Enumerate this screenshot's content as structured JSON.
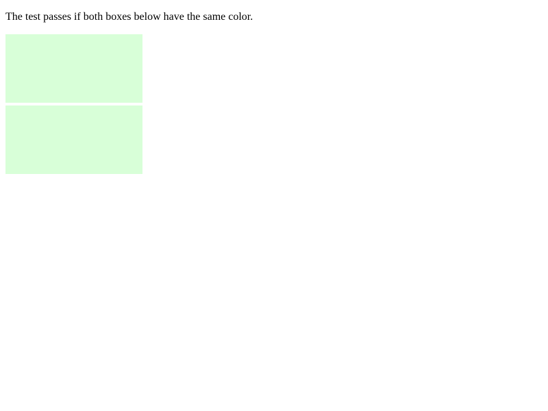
{
  "instruction": {
    "text": "The test passes if both boxes below have the same color."
  },
  "boxes": {
    "items": [
      {
        "color": "#d8ffd8"
      },
      {
        "color": "#d8ffd8"
      }
    ]
  },
  "colors": {
    "background": "#ffffff",
    "text": "#000000"
  }
}
